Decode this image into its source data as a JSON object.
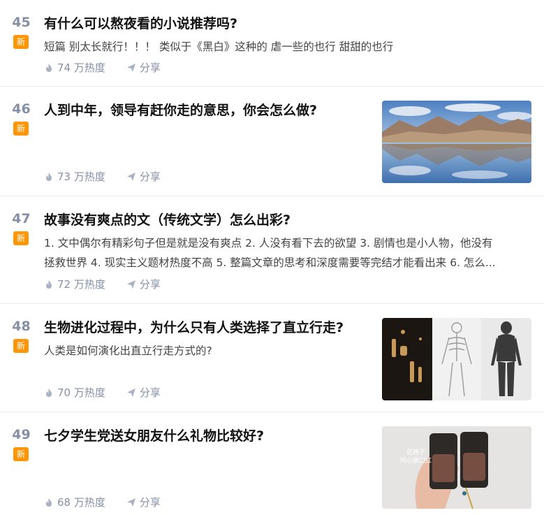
{
  "items": [
    {
      "rank": "45",
      "badge": "新",
      "title": "有什么可以熬夜看的小说推荐吗?",
      "excerpt": "短篇 别太长就行！！！ 类似于《黑白》这种的 虐一些的也行 甜甜的也行",
      "heat": "74 万热度",
      "share": "分享"
    },
    {
      "rank": "46",
      "badge": "新",
      "title": "人到中年，领导有赶你走的意思，你会怎么做?",
      "heat": "73 万热度",
      "share": "分享",
      "thumb": "mountain-lake-reflection"
    },
    {
      "rank": "47",
      "badge": "新",
      "title": "故事没有爽点的文（传统文学）怎么出彩?",
      "excerpt_line1": "1. 文中偶尔有精彩句子但是就是没有爽点 2. 人没有看下去的欲望 3. 剧情也是小人物，他没有",
      "excerpt_line2": "拯救世界 4. 现实主义题材热度不高 5. 整篇文章的思考和深度需要等完结才能看出来 6. 怎么...",
      "heat": "72 万热度",
      "share": "分享"
    },
    {
      "rank": "48",
      "badge": "新",
      "title": "生物进化过程中，为什么只有人类选择了直立行走?",
      "excerpt": "人类是如何演化出直立行走方式的?",
      "heat": "70 万热度",
      "share": "分享",
      "thumb": "human-evolution-skeletons"
    },
    {
      "rank": "49",
      "badge": "新",
      "title": "七夕学生党送女朋友什么礼物比较好?",
      "heat": "68 万热度",
      "share": "分享",
      "thumb": "lipstick-gift",
      "thumb_text_1": "花西子",
      "thumb_text_2": "同心锁口红"
    }
  ],
  "colors": {
    "badge": "#ff9607",
    "rank": "#8590a6",
    "meta": "#8590a6"
  }
}
